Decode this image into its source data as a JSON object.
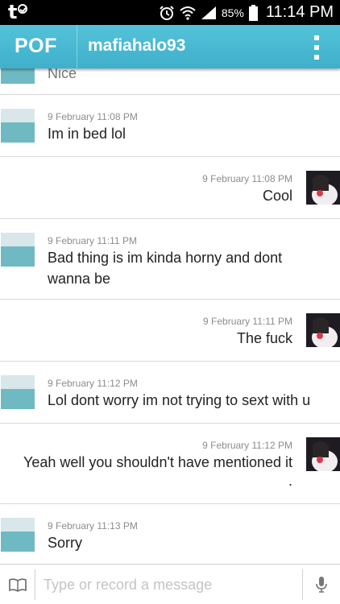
{
  "status_bar": {
    "carrier_glyph": "t",
    "battery": "85%",
    "time": "11:14 PM",
    "icons": [
      "carrier-t-icon",
      "alarm-icon",
      "wifi-icon",
      "signal-icon",
      "battery-icon"
    ]
  },
  "header": {
    "brand": "POF",
    "username": "mafiahalo93",
    "menu_icon": "overflow-menu-icon",
    "accent": "#4cbad3"
  },
  "messages": [
    {
      "side": "left",
      "timestamp": "",
      "text": "Nice"
    },
    {
      "side": "left",
      "timestamp": "9 February 11:08 PM",
      "text": "Im in bed lol"
    },
    {
      "side": "right",
      "timestamp": "9 February 11:08 PM",
      "text": "Cool"
    },
    {
      "side": "left",
      "timestamp": "9 February 11:11 PM",
      "text": "Bad thing is im kinda horny and dont wanna be"
    },
    {
      "side": "right",
      "timestamp": "9 February 11:11 PM",
      "text": "The fuck"
    },
    {
      "side": "left",
      "timestamp": "9 February 11:12 PM",
      "text": "Lol dont worry im not trying to sext with u"
    },
    {
      "side": "right",
      "timestamp": "9 February 11:12 PM",
      "text": "Yeah well you shouldn't have mentioned it",
      "text2": "."
    },
    {
      "side": "left",
      "timestamp": "9 February 11:13 PM",
      "text": "Sorry"
    }
  ],
  "composer": {
    "placeholder": "Type or record a message",
    "left_icon": "book-icon",
    "right_icon": "microphone-icon"
  }
}
